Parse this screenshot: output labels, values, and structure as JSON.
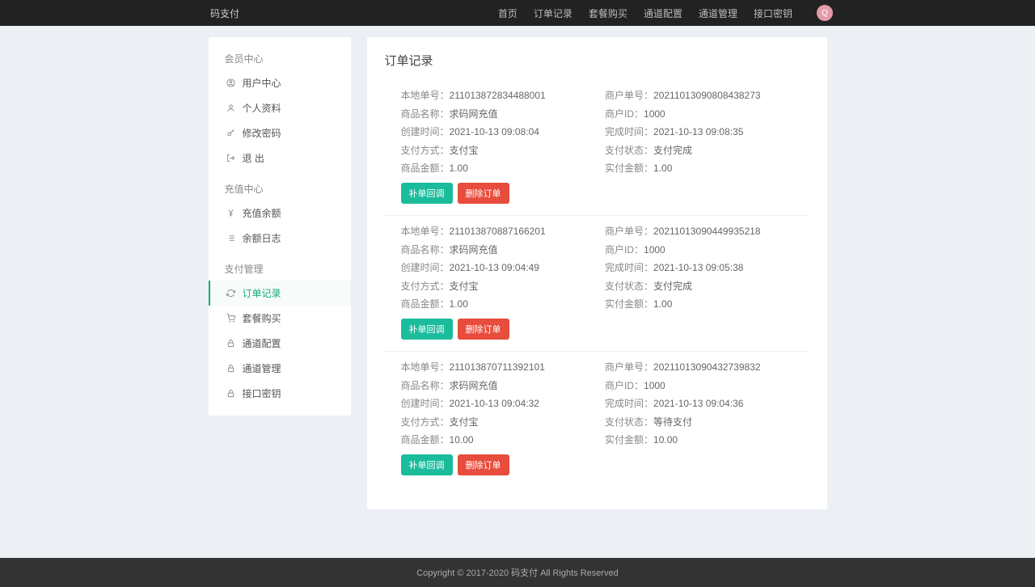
{
  "brand": "码支付",
  "topnav": {
    "items": [
      "首页",
      "订单记录",
      "套餐购买",
      "通道配置",
      "通道管理",
      "接口密钥"
    ],
    "avatar_letter": "Q"
  },
  "sidebar": {
    "sections": [
      {
        "title": "会员中心",
        "items": [
          {
            "icon": "user-circle-icon",
            "label": "用户中心",
            "active": false
          },
          {
            "icon": "user-icon",
            "label": "个人资料",
            "active": false
          },
          {
            "icon": "key-icon",
            "label": "修改密码",
            "active": false
          },
          {
            "icon": "logout-icon",
            "label": "退 出",
            "active": false
          }
        ]
      },
      {
        "title": "充值中心",
        "items": [
          {
            "icon": "yen-icon",
            "label": "充值余额",
            "active": false
          },
          {
            "icon": "list-icon",
            "label": "余额日志",
            "active": false
          }
        ]
      },
      {
        "title": "支付管理",
        "items": [
          {
            "icon": "refresh-icon",
            "label": "订单记录",
            "active": true
          },
          {
            "icon": "cart-icon",
            "label": "套餐购买",
            "active": false
          },
          {
            "icon": "lock-icon",
            "label": "通道配置",
            "active": false
          },
          {
            "icon": "lock-icon",
            "label": "通道管理",
            "active": false
          },
          {
            "icon": "lock-icon",
            "label": "接口密钥",
            "active": false
          }
        ]
      }
    ]
  },
  "page_title": "订单记录",
  "field_labels": {
    "local_no": "本地单号：",
    "merchant_no": "商户单号：",
    "goods_name": "商品名称：",
    "merchant_id": "商户ID：",
    "create_time": "创建时间：",
    "finish_time": "完成时间：",
    "pay_method": "支付方式：",
    "pay_status": "支付状态：",
    "goods_amount": "商品金额：",
    "paid_amount": "实付金额："
  },
  "buttons": {
    "callback": "补单回调",
    "delete": "删除订单"
  },
  "orders": [
    {
      "local_no": "211013872834488001",
      "merchant_no": "20211013090808438273",
      "goods_name": "求码网充值",
      "merchant_id": "1000",
      "create_time": "2021-10-13 09:08:04",
      "finish_time": "2021-10-13 09:08:35",
      "pay_method": "支付宝",
      "pay_status": "支付完成",
      "goods_amount": "1.00",
      "paid_amount": "1.00"
    },
    {
      "local_no": "211013870887166201",
      "merchant_no": "20211013090449935218",
      "goods_name": "求码网充值",
      "merchant_id": "1000",
      "create_time": "2021-10-13 09:04:49",
      "finish_time": "2021-10-13 09:05:38",
      "pay_method": "支付宝",
      "pay_status": "支付完成",
      "goods_amount": "1.00",
      "paid_amount": "1.00"
    },
    {
      "local_no": "211013870711392101",
      "merchant_no": "20211013090432739832",
      "goods_name": "求码网充值",
      "merchant_id": "1000",
      "create_time": "2021-10-13 09:04:32",
      "finish_time": "2021-10-13 09:04:36",
      "pay_method": "支付宝",
      "pay_status": "等待支付",
      "goods_amount": "10.00",
      "paid_amount": "10.00"
    }
  ],
  "footer": "Copyright © 2017-2020 码支付 All Rights Reserved"
}
